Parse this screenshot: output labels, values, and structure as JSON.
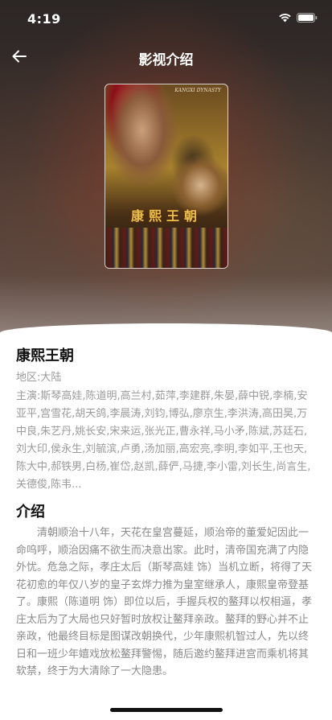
{
  "status_bar": {
    "time": "4:19"
  },
  "nav": {
    "title": "影视介绍"
  },
  "poster": {
    "top_text": "KANGXI DYNASTY",
    "title": "康熙王朝"
  },
  "detail": {
    "name": "康熙王朝",
    "region": "地区:大陆",
    "cast": "主演:斯琴高娃,陈道明,高兰村,茹萍,李建群,朱晏,薛中锐,李楠,安亚平,宫雪花,胡天鸽,李晨涛,刘钧,博弘,廖京生,李洪涛,高田昊,万中良,朱艺丹,姚长安,宋来运,张光正,曹永祥,马小矛,陈斌,苏廷石,刘大印,侯永生,刘毓滨,卢勇,汤加丽,高宏亮,李明,李如平,王也天,陈大中,郝铁男,白杨,崔岱,赵凯,薛俨,马捷,李小雷,刘长生,尚言生,关德俊,陈韦...",
    "intro_heading": "介绍",
    "intro_text": "清朝顺治十八年，天花在皇宫蔓延，顺治帝的董爱妃因此一命呜呼，顺治因痛不欲生而决意出家。此时，清帝国充满了内隐外忧。危急之际，孝庄太后（斯琴高娃 饰）当机立断，将得了天花初愈的年仅八岁的皇子玄烨力推为皇室继承人，康熙皇帝登基了。康熙（陈道明 饰）即位以后，手握兵权的鳌拜以权相逼，孝庄太后为了大局也只好暂时放权让鳌拜亲政。鳌拜的野心并不止亲政，他最终目标是图谋改朝换代，少年康熙机智过人，先以终日和一班少年嬉戏放松鳌拜警惕，随后邀约鳌拜进宫而乘机将其软禁，终于为大清除了一大隐患。"
  },
  "colors": {
    "text_primary": "#111111",
    "text_secondary": "#9a9a9a",
    "background": "#ffffff"
  }
}
